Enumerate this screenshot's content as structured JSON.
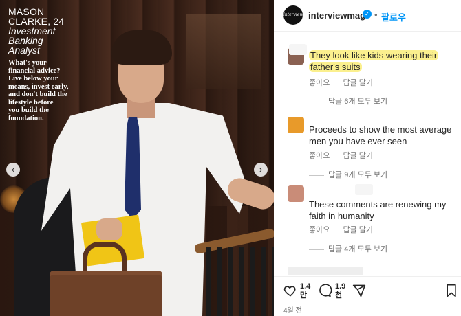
{
  "post": {
    "caption_name": "MASON\nCLARKE, 24",
    "caption_role": "Investment\nBanking\nAnalyst",
    "caption_quote": "What's your\nfinancial advice?\nLive below your\nmeans, invest early,\nand don't build the\nlifestyle before\nyou build the\nfoundation."
  },
  "nav": {
    "prev": "‹",
    "next": "›"
  },
  "header": {
    "avatar_text": "interview",
    "username": "interviewmag",
    "verified_glyph": "✓",
    "separator": "•",
    "follow_label": "팔로우"
  },
  "comments": [
    {
      "avatar_color": "#8a6152",
      "text": "They look like kids wearing their father's suits",
      "highlighted": true,
      "like_label": "좋아요",
      "reply_label": "답글 달기",
      "replies_label": "답글 6개 모두 보기"
    },
    {
      "avatar_color": "#e89a2a",
      "text": "Proceeds to show the most average men you have ever seen",
      "highlighted": false,
      "like_label": "좋아요",
      "reply_label": "답글 달기",
      "replies_label": "답글 9개 모두 보기"
    },
    {
      "avatar_color": "#c98c78",
      "text": "These comments are renewing my faith in humanity",
      "highlighted": false,
      "like_label": "좋아요",
      "reply_label": "답글 달기",
      "replies_label": "답글 4개 모두 보기"
    }
  ],
  "actions": {
    "icons": [
      "heart-icon",
      "comment-icon",
      "share-icon",
      "bookmark-icon"
    ],
    "likes_count": "1.4\n만",
    "comments_count": "1.9\n천",
    "time_ago": "4일 전"
  },
  "colors": {
    "accent": "#0095f6",
    "highlight": "#fbf08e",
    "text": "#262626",
    "muted": "#737373"
  }
}
